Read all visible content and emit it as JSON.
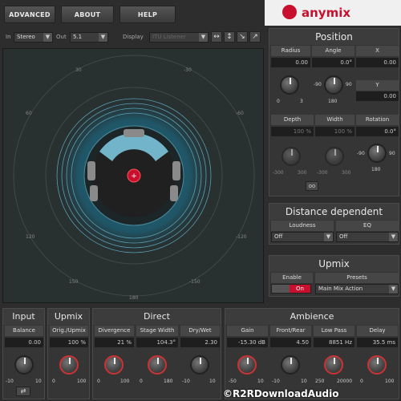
{
  "top": {
    "advanced": "ADVANCED",
    "about": "ABOUT",
    "help": "HELP",
    "brand": "anymix"
  },
  "toolbar": {
    "in_label": "In",
    "in_value": "Stereo",
    "out_label": "Out",
    "out_value": "5.1",
    "display_label": "Display",
    "display_value": "ITU Listener"
  },
  "stage": {
    "ring_labels": [
      "-0",
      "30",
      "-30",
      "60",
      "-60",
      "120",
      "-120",
      "150",
      "-150",
      "180"
    ]
  },
  "position": {
    "title": "Position",
    "radius": {
      "label": "Radius",
      "value": "0.00",
      "min": "0",
      "max": "3"
    },
    "angle": {
      "label": "Angle",
      "value": "0.0°",
      "left": "-90",
      "right": "90",
      "bottom": "180"
    },
    "x": {
      "label": "X",
      "value": "0.00"
    },
    "y": {
      "label": "Y",
      "value": "0.00"
    },
    "depth": {
      "label": "Depth",
      "value": "100 %",
      "min": "-300",
      "max": "300"
    },
    "width": {
      "label": "Width",
      "value": "100 %",
      "min": "-300",
      "max": "300"
    },
    "rotation": {
      "label": "Rotation",
      "value": "0.0°",
      "left": "-90",
      "right": "90",
      "bottom": "180"
    },
    "link": "oo"
  },
  "distance": {
    "title": "Distance dependent",
    "loudness_label": "Loudness",
    "loudness_value": "Off",
    "eq_label": "EQ",
    "eq_value": "Off"
  },
  "upmix_right": {
    "title": "Upmix",
    "enable_label": "Enable",
    "enable_state": "On",
    "presets_label": "Presets",
    "preset_value": "Main Mix Action"
  },
  "input": {
    "title": "Input",
    "balance_label": "Balance",
    "balance_value": "0.00",
    "min": "-10",
    "max": "10"
  },
  "upmix_bottom": {
    "title": "Upmix",
    "orig_label": "Orig./Upmix",
    "orig_value": "100 %",
    "min": "0",
    "max": "100"
  },
  "direct": {
    "title": "Direct",
    "divergence": {
      "label": "Divergence",
      "value": "21 %",
      "min": "0",
      "max": "100"
    },
    "stage_width": {
      "label": "Stage Width",
      "value": "104.3°",
      "min": "0",
      "max": "180"
    },
    "dry_wet": {
      "label": "Dry/Wet",
      "value": "2.30",
      "min": "-10",
      "max": "10"
    }
  },
  "ambience": {
    "title": "Ambience",
    "gain": {
      "label": "Gain",
      "value": "-15.30 dB",
      "min": "-50",
      "max": "10"
    },
    "front_rear": {
      "label": "Front/Rear",
      "value": "4.50",
      "min": "-10",
      "max": "10"
    },
    "low_pass": {
      "label": "Low Pass",
      "value": "8851 Hz",
      "min": "250",
      "max": "20000"
    },
    "delay": {
      "label": "Delay",
      "value": "35.5 ms",
      "min": "0",
      "max": "100"
    }
  },
  "watermark": "©R2RDownloadAudio"
}
